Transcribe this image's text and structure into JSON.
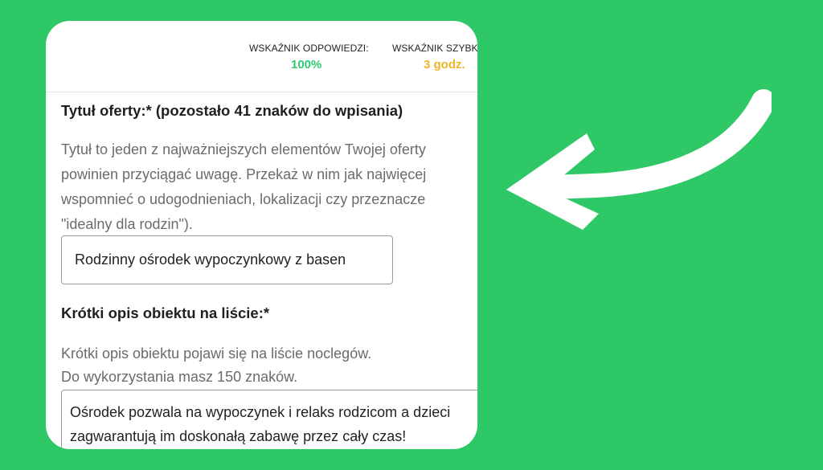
{
  "stats": {
    "response_rate_label": "WSKAŹNIK ODPOWIEDZI:",
    "response_rate_value": "100%",
    "speed_label": "WSKAŹNIK SZYBK",
    "speed_value": "3 godz.",
    "colors": {
      "response": "#2ecc71",
      "speed": "#f0b429"
    }
  },
  "title_section": {
    "heading": "Tytuł oferty:* (pozostało 41 znaków do wpisania)",
    "description_lines": [
      "Tytuł to jeden z najważniejszych elementów Twojej oferty",
      "powinien przyciągać uwagę. Przekaż w nim jak najwięcej",
      "wspomnieć o udogodnieniach, lokalizacji czy przeznacze",
      "\"idealny dla rodzin\")."
    ],
    "input_value": "Rodzinny ośrodek wypoczynkowy z basen"
  },
  "short_desc_section": {
    "heading": "Krótki opis obiektu na liście:*",
    "description_lines": [
      "Krótki opis obiektu pojawi się na liście noclegów.",
      "Do wykorzystania masz 150 znaków."
    ],
    "textarea_lines": [
      "Ośrodek pozwala na wypoczynek i relaks rodzicom a dzieci",
      "zagwarantują im doskonałą zabawę przez cały czas!"
    ]
  },
  "background_color": "#2ec866",
  "arrow_icon": "curved-arrow-left-icon"
}
